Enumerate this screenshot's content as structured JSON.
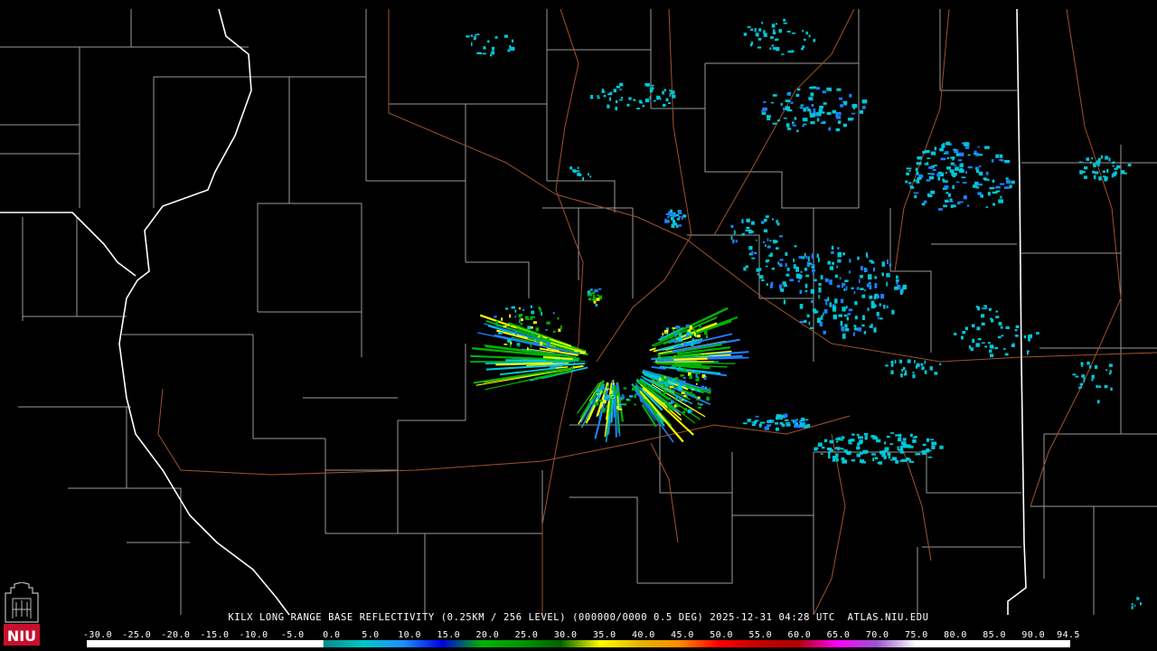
{
  "product_caption": "KILX LONG RANGE BASE REFLECTIVITY (0.25KM / 256 LEVEL) (000000/0000 0.5 DEG) 2025-12-31 04:28 UTC  ATLAS.NIU.EDU",
  "logo_text": "NIU",
  "legend": {
    "tick_labels": [
      "-30.0",
      "-25.0",
      "-20.0",
      "-15.0",
      "-10.0",
      "-5.0",
      "0.0",
      "5.0",
      "10.0",
      "15.0",
      "20.0",
      "25.0",
      "30.0",
      "35.0",
      "40.0",
      "45.0",
      "50.0",
      "55.0",
      "60.0",
      "65.0",
      "70.0",
      "75.0",
      "80.0",
      "85.0",
      "90.0",
      "94.5"
    ],
    "min": -30.0,
    "max": 94.5,
    "color_stops": [
      {
        "dbz": -30,
        "color": "#ffffff"
      },
      {
        "dbz": -0.1,
        "color": "#ffffff"
      },
      {
        "dbz": 0,
        "color": "#0a8a8a"
      },
      {
        "dbz": 5,
        "color": "#00c8c8"
      },
      {
        "dbz": 10,
        "color": "#1e90ff"
      },
      {
        "dbz": 15,
        "color": "#0000e6"
      },
      {
        "dbz": 20,
        "color": "#00b400"
      },
      {
        "dbz": 25,
        "color": "#009600"
      },
      {
        "dbz": 30,
        "color": "#006400"
      },
      {
        "dbz": 35,
        "color": "#ffff00"
      },
      {
        "dbz": 40,
        "color": "#e6b400"
      },
      {
        "dbz": 45,
        "color": "#ff8c00"
      },
      {
        "dbz": 50,
        "color": "#ff0000"
      },
      {
        "dbz": 55,
        "color": "#c80000"
      },
      {
        "dbz": 60,
        "color": "#b40000"
      },
      {
        "dbz": 65,
        "color": "#ff00ff"
      },
      {
        "dbz": 70,
        "color": "#9955cc"
      },
      {
        "dbz": 75,
        "color": "#ffffff"
      },
      {
        "dbz": 94.5,
        "color": "#ffffff"
      }
    ]
  },
  "colors": {
    "background": "#000000",
    "county_lines": "#9a9a9a",
    "state_lines": "#ffffff",
    "highways": "#a0522d",
    "echo_light": "#00c8d8",
    "echo_medium": "#1e80ff",
    "echo_strong": "#00b400",
    "echo_heavy": "#ffff00",
    "logo_red": "#c8102e"
  }
}
